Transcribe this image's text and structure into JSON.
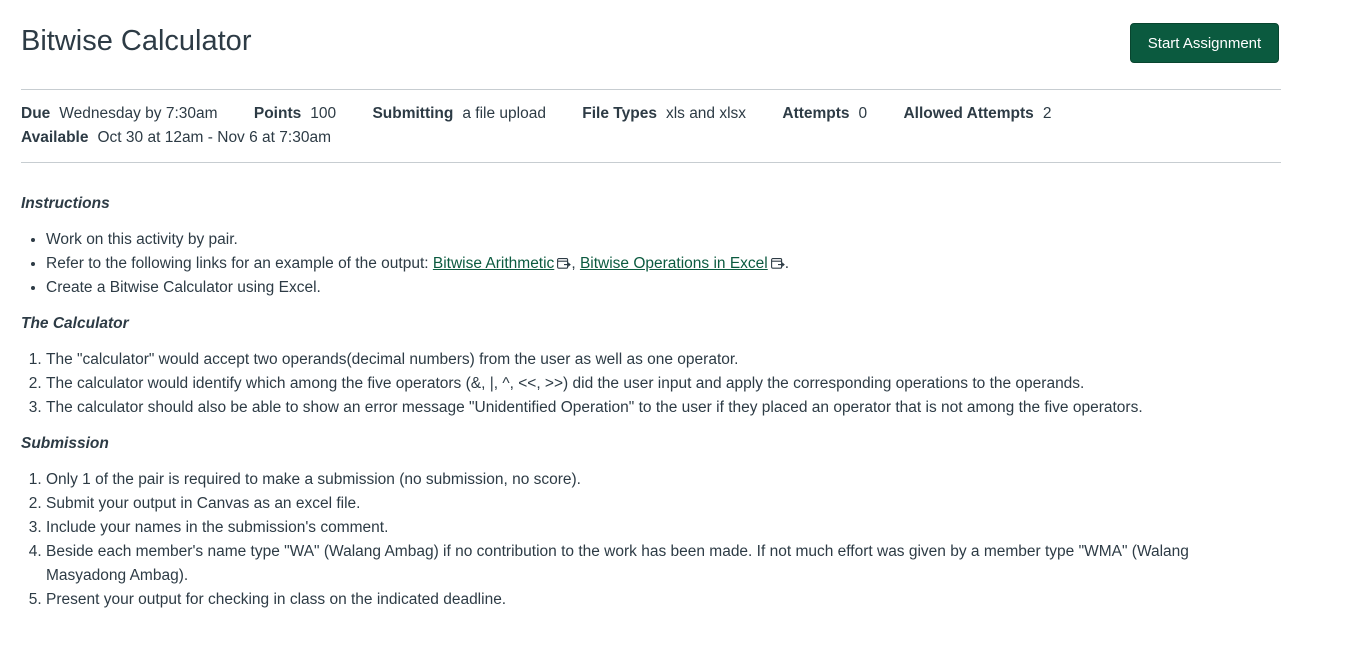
{
  "assignment": {
    "title": "Bitwise Calculator",
    "start_button": "Start Assignment"
  },
  "details": {
    "due_label": "Due",
    "due_value": "Wednesday by 7:30am",
    "points_label": "Points",
    "points_value": "100",
    "submitting_label": "Submitting",
    "submitting_value": "a file upload",
    "file_types_label": "File Types",
    "file_types_value": "xls and xlsx",
    "attempts_label": "Attempts",
    "attempts_value": "0",
    "allowed_attempts_label": "Allowed Attempts",
    "allowed_attempts_value": "2",
    "available_label": "Available",
    "available_value": "Oct 30 at 12am - Nov 6 at 7:30am"
  },
  "instructions": {
    "heading": "Instructions",
    "item1": "Work on this activity by pair.",
    "item2_prefix": "Refer to the following links for an example of the output: ",
    "link1": "Bitwise Arithmetic",
    "sep": ", ",
    "link2": "Bitwise Operations in Excel",
    "end": ".",
    "item3": "Create a Bitwise Calculator using Excel."
  },
  "calculator": {
    "heading": "The Calculator",
    "items": [
      "The \"calculator\" would accept two operands(decimal numbers) from the user as well as one operator.",
      "The calculator would identify which among the five operators (&, |, ^, <<, >>) did the user input and apply the corresponding operations to the operands.",
      "The calculator should also be able to show an error message \"Unidentified Operation\" to the user if they placed an operator that is not among the five operators."
    ]
  },
  "submission": {
    "heading": "Submission",
    "items": [
      "Only 1 of the pair is required to make a submission (no submission, no score).",
      "Submit your output in Canvas as an excel file.",
      "Include your names in the submission's comment.",
      "Beside each member's name type \"WA\" (Walang Ambag) if no contribution to the work has been made. If not much effort was given by a member type \"WMA\" (Walang Masyadong Ambag).",
      "Present your output for checking in class on the indicated deadline."
    ]
  },
  "icons": {
    "external_link": "external-link-icon"
  },
  "colors": {
    "button_bg": "#0b5a3f",
    "link": "#0b5a3f",
    "text": "#2d3b45"
  }
}
